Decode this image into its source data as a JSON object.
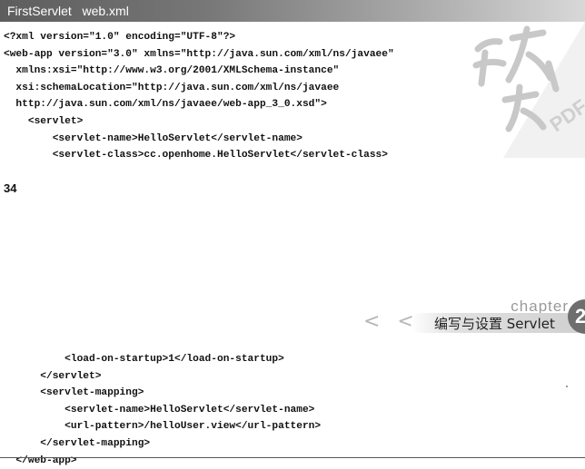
{
  "header": {
    "title": "FirstServlet   web.xml"
  },
  "code": {
    "top_lines": [
      "<?xml version=\"1.0\" encoding=\"UTF-8\"?>",
      "<web-app version=\"3.0\" xmlns=\"http://java.sun.com/xml/ns/javaee\"",
      "  xmlns:xsi=\"http://www.w3.org/2001/XMLSchema-instance\"",
      "  xsi:schemaLocation=\"http://java.sun.com/xml/ns/javaee",
      "  http://java.sun.com/xml/ns/javaee/web-app_3_0.xsd\">",
      "    <servlet>",
      "        <servlet-name>HelloServlet</servlet-name>",
      "        <servlet-class>cc.openhome.HelloServlet</servlet-class>"
    ],
    "bottom_lines": [
      "          <load-on-startup>1</load-on-startup>",
      "      </servlet>",
      "      <servlet-mapping>",
      "          <servlet-name>HelloServlet</servlet-name>",
      "          <url-pattern>/helloUser.view</url-pattern>",
      "      </servlet-mapping>",
      "  </web-app>"
    ]
  },
  "page_number": "34",
  "chapter": {
    "word": "chapter",
    "chevrons": "< < <",
    "title": "编写与设置 Servlet",
    "number": "2"
  },
  "watermark": {
    "text": "PDF",
    "color": "#c8c8c8"
  },
  "colors": {
    "header_bg_start": "#5d5d5d",
    "header_bg_end": "#d8d8d8",
    "header_text": "#ffffff",
    "badge_bg": "#6e6e6e"
  }
}
